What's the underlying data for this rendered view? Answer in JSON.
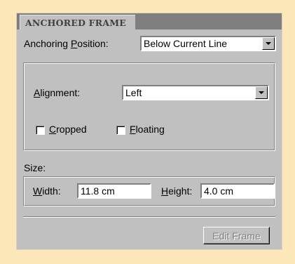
{
  "panel": {
    "tab_label": "ANCHORED FRAME"
  },
  "anchoring": {
    "label_pre": "Anchoring ",
    "label_mnemonic": "P",
    "label_post": "osition:",
    "value": "Below Current Line"
  },
  "alignment": {
    "label_mnemonic": "A",
    "label_post": "lignment:",
    "value": "Left"
  },
  "cropped": {
    "label_mnemonic": "C",
    "label_post": "ropped",
    "checked": false
  },
  "floating": {
    "label_mnemonic": "F",
    "label_post": "loating",
    "checked": false
  },
  "size": {
    "label": "Size:",
    "width_label_mnemonic": "W",
    "width_label_post": "idth:",
    "width_value": "11.8 cm",
    "height_label_mnemonic": "H",
    "height_label_post": "eight:",
    "height_value": "4.0 cm"
  },
  "edit_frame_button": {
    "label": "Edit Frame",
    "enabled": false
  }
}
